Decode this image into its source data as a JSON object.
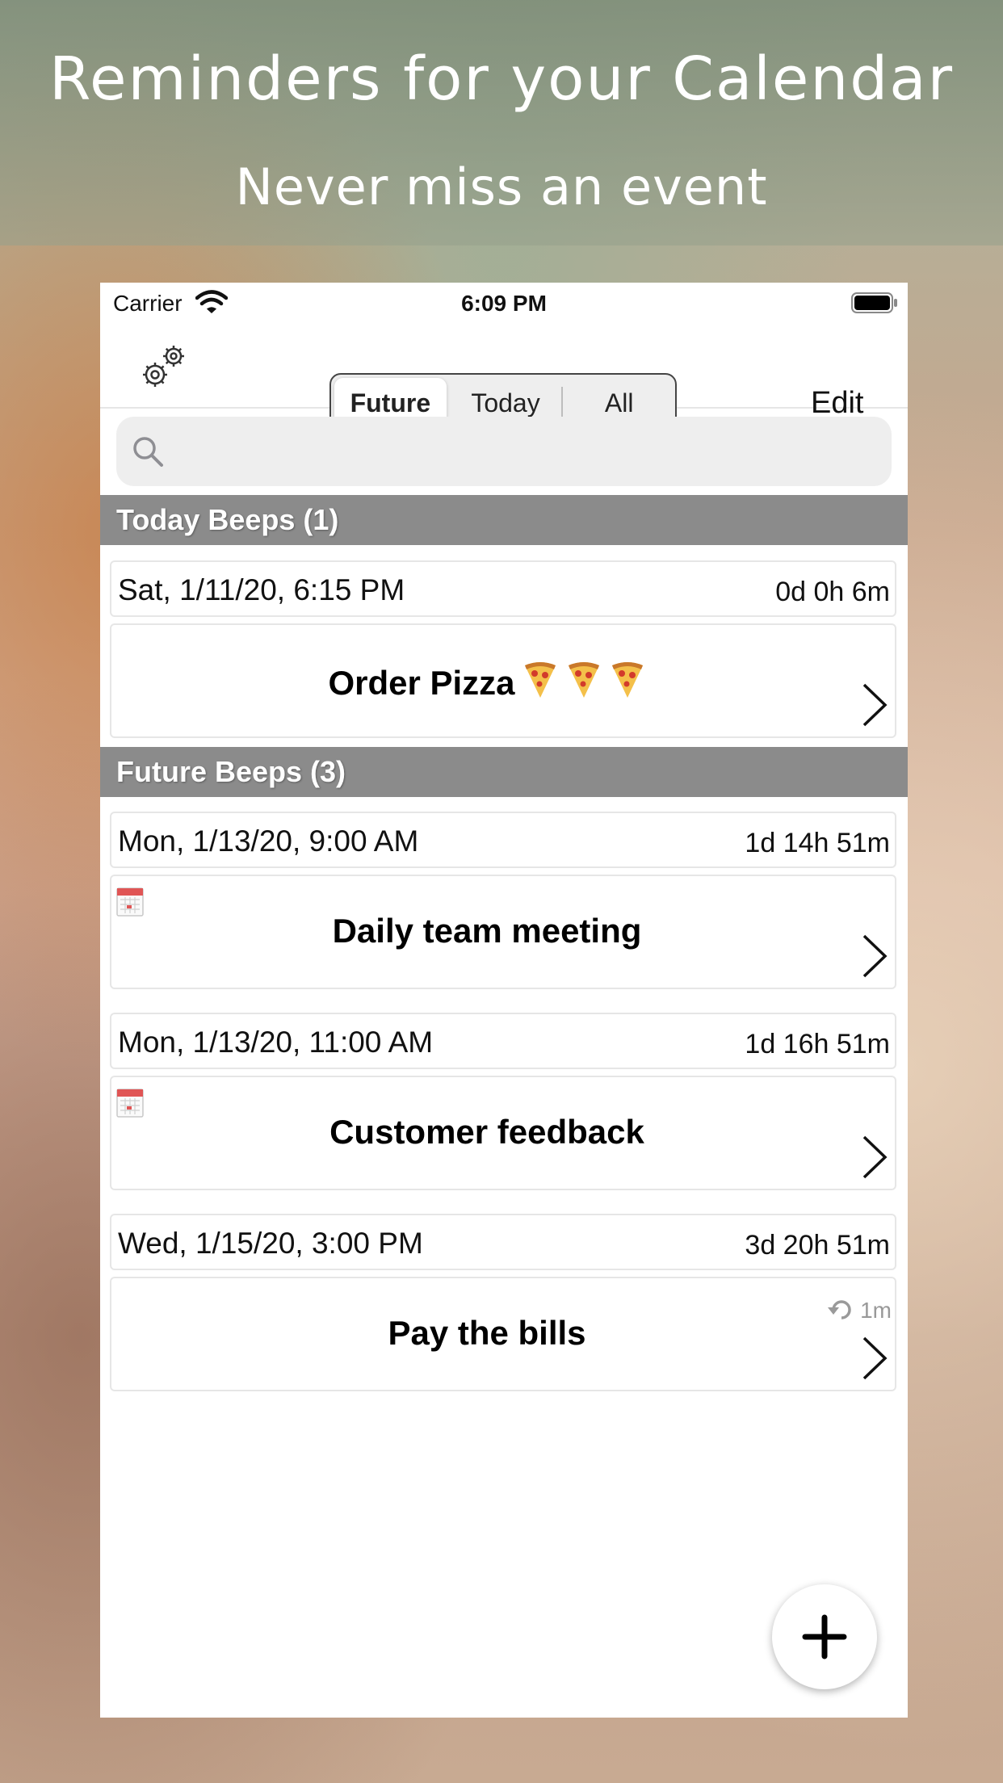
{
  "hero": {
    "title": "Reminders for your Calendar",
    "subtitle": "Never miss an event"
  },
  "status_bar": {
    "carrier": "Carrier",
    "time": "6:09 PM",
    "icons": [
      "wifi-icon",
      "battery-icon"
    ]
  },
  "nav": {
    "settings_icon": "settings-gears-icon",
    "segments": [
      "Future",
      "Today",
      "All"
    ],
    "selected_segment": "Future",
    "edit_label": "Edit"
  },
  "search": {
    "placeholder": "",
    "value": ""
  },
  "sections": [
    {
      "header": "Today Beeps (1)",
      "items": [
        {
          "date": "Sat, 1/11/20, 6:15 PM",
          "countdown": "0d 0h 6m",
          "title": "Order Pizza",
          "emoji_icons": [
            "pizza-icon",
            "pizza-icon",
            "pizza-icon"
          ]
        }
      ]
    },
    {
      "header": "Future Beeps (3)",
      "items": [
        {
          "date": "Mon, 1/13/20, 9:00 AM",
          "countdown": "1d 14h 51m",
          "title": "Daily team meeting",
          "icon": "calendar-icon"
        },
        {
          "date": "Mon, 1/13/20, 11:00 AM",
          "countdown": "1d 16h 51m",
          "title": "Customer feedback",
          "icon": "calendar-icon"
        },
        {
          "date": "Wed, 1/15/20, 3:00 PM",
          "countdown": "3d 20h 51m",
          "title": "Pay the bills",
          "repeat": "1m",
          "icon": "repeat-icon"
        }
      ]
    }
  ],
  "fab": {
    "icon": "plus-icon"
  },
  "colors": {
    "section_header_bg": "#8b8b8b",
    "card_border": "#e6e6e6",
    "repeat_text": "#999999"
  }
}
